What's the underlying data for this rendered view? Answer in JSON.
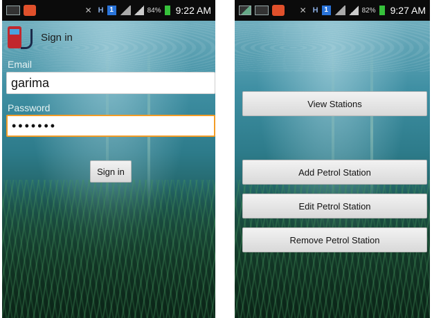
{
  "left_screen": {
    "status_bar": {
      "battery": "84%",
      "time": "9:22 AM",
      "network": "H",
      "badge": "1"
    },
    "header": {
      "title": "Sign in",
      "icon": "petrol-pump-icon"
    },
    "email": {
      "label": "Email",
      "value": "garima"
    },
    "password": {
      "label": "Password",
      "value": "•••••••"
    },
    "sign_in_button": "Sign in"
  },
  "right_screen": {
    "status_bar": {
      "battery": "82%",
      "time": "9:27 AM",
      "network": "H",
      "badge": "1"
    },
    "buttons": {
      "view": "View Stations",
      "add": "Add Petrol Station",
      "edit": "Edit Petrol Station",
      "remove": "Remove Petrol Station"
    }
  },
  "colors": {
    "focus_border": "#f39c26",
    "status_bar_bg": "#0b0b0b",
    "battery": "#36c13b"
  }
}
